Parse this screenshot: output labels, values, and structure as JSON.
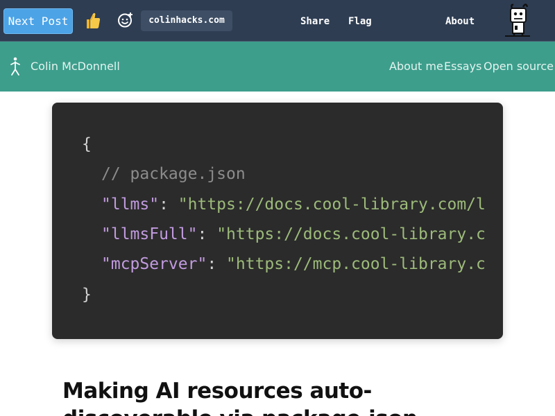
{
  "topbar": {
    "next_post_label": "Next Post",
    "like_icon": "thumbs-up-icon",
    "reactions_icon": "smiley-add-icon",
    "domain": "colinhacks.com",
    "share_label": "Share",
    "flag_label": "Flag",
    "about_label": "About",
    "mascot_icon": "tumblr-mascot-icon",
    "colors": {
      "background": "#2e3d52",
      "button": "#4ca3e6"
    }
  },
  "site": {
    "name": "Colin McDonnell",
    "logo_icon": "figure-logo-icon",
    "nav": {
      "about_me": "About me",
      "essays": "Essays",
      "open_source": "Open source"
    },
    "colors": {
      "header": "#3d9e8c"
    }
  },
  "code_image": {
    "open_brace": "{",
    "comment": "// package.json",
    "lines": [
      {
        "key": "\"llms\"",
        "sep": ": ",
        "value": "\"https://docs.cool-library.com/l"
      },
      {
        "key": "\"llmsFull\"",
        "sep": ": ",
        "value": "\"https://docs.cool-library.c"
      },
      {
        "key": "\"mcpServer\"",
        "sep": ": ",
        "value": "\"https://mcp.cool-library.c"
      }
    ],
    "close_brace": "}"
  },
  "article": {
    "title": "Making AI resources auto-discoverable via package.json"
  }
}
